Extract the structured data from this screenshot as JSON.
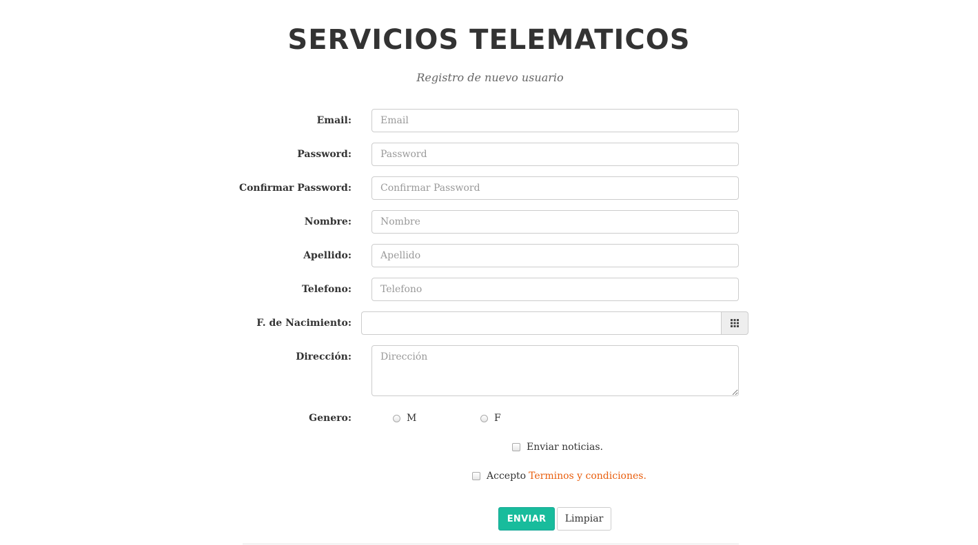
{
  "header": {
    "title": "SERVICIOS TELEMATICOS",
    "subtitle": "Registro de nuevo usuario"
  },
  "form": {
    "email": {
      "label": "Email:",
      "placeholder": "Email",
      "value": ""
    },
    "password": {
      "label": "Password:",
      "placeholder": "Password",
      "value": ""
    },
    "confirm_password": {
      "label": "Confirmar Password:",
      "placeholder": "Confirmar Password",
      "value": ""
    },
    "nombre": {
      "label": "Nombre:",
      "placeholder": "Nombre",
      "value": ""
    },
    "apellido": {
      "label": "Apellido:",
      "placeholder": "Apellido",
      "value": ""
    },
    "telefono": {
      "label": "Telefono:",
      "placeholder": "Telefono",
      "value": ""
    },
    "fecha_nacimiento": {
      "label": "F. de Nacimiento:",
      "value": "",
      "icon": "calendar-grid-icon"
    },
    "direccion": {
      "label": "Dirección:",
      "placeholder": "Dirección",
      "value": ""
    },
    "genero": {
      "label": "Genero:",
      "options": [
        {
          "label": "M",
          "checked": false
        },
        {
          "label": "F",
          "checked": false
        }
      ]
    },
    "noticias": {
      "label": "Enviar noticias.",
      "checked": false
    },
    "terminos": {
      "prefix": "Accepto",
      "link_text": "Terminos y condiciones.",
      "checked": false
    }
  },
  "actions": {
    "submit_label": "ENVIAR",
    "reset_label": "Limpiar"
  },
  "colors": {
    "primary": "#18bc9c",
    "link": "#e85d0c",
    "text": "#333333",
    "placeholder": "#999999",
    "border": "#cccccc"
  }
}
